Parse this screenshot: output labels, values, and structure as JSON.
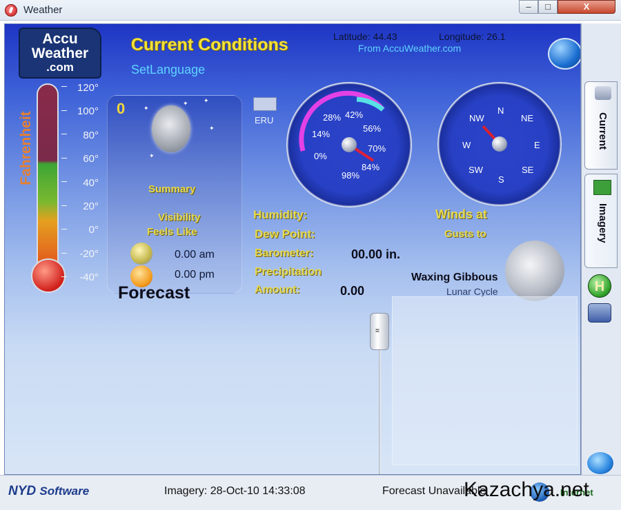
{
  "window": {
    "title": "Weather",
    "min_label": "–",
    "max_label": "□",
    "close_label": "X"
  },
  "header": {
    "logo": {
      "line1": "Accu",
      "line2": "Weather",
      "line3": ".com"
    },
    "title": "Current Conditions",
    "set_language": "SetLanguage",
    "latitude": "Latitude: 44.43",
    "longitude": "Longitude: 26.1",
    "from_link": "From AccuWeather.com"
  },
  "thermometer": {
    "unit_label": "Fahrenheit",
    "scale": [
      "120°",
      "100°",
      "80°",
      "60°",
      "40°",
      "20°",
      "0°",
      "-20°",
      "-40°"
    ]
  },
  "summary": {
    "temperature": "0",
    "summary_label": "Summary",
    "visibility_label": "Visibility",
    "feels_like_label": "Feels Like",
    "sunrise": "0.00 am",
    "sunset": "0.00 pm",
    "forecast_label": "Forecast"
  },
  "eru": {
    "label": "ERU"
  },
  "humidity_gauge": {
    "labels": [
      "28%",
      "42%",
      "14%",
      "56%",
      "0%",
      "70%",
      "98%",
      "84%"
    ]
  },
  "wind_gauge": {
    "labels": [
      "NW",
      "N",
      "NE",
      "W",
      "E",
      "SW",
      "S",
      "SE"
    ]
  },
  "readouts": {
    "humidity_label": "Humidity:",
    "dew_point_label": "Dew Point:",
    "barometer_label": "Barometer:",
    "barometer_value": "00.00 in.",
    "precipitation_label": "Precipitation",
    "amount_label": "Amount:",
    "amount_value": "0.00",
    "winds_label": "Winds at",
    "gusts_label": "Gusts to"
  },
  "moon": {
    "phase": "Waxing Gibbous",
    "lunar_cycle_label": "Lunar Cycle"
  },
  "side_tabs": {
    "current": "Current",
    "imagery": "Imagery",
    "h_label": "H"
  },
  "status_bar": {
    "logo_a": "NYD",
    "logo_b": "Software",
    "imagery_status": "Imagery: 28-Oct-10 14:33:08",
    "forecast_status": "Forecast Unavailable",
    "internet_label": "Internet",
    "watermark": "Kazachya.net"
  },
  "colors": {
    "title_yellow": "#f4e23a",
    "label_yellow": "#e5d94e",
    "link_cyan": "#5fd4ff",
    "gauge_blue": "#2740c4",
    "help_green": "#35b848"
  }
}
